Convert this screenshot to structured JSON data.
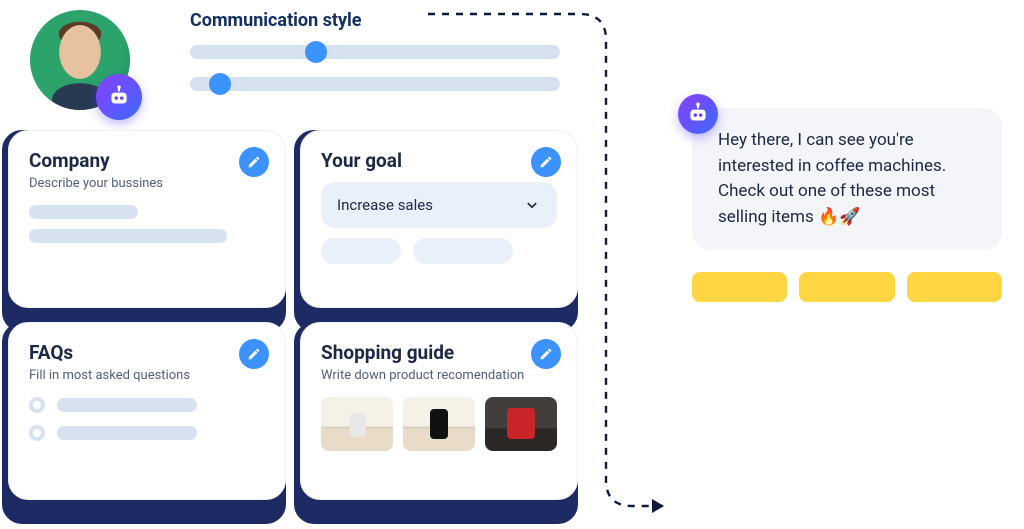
{
  "communication": {
    "title": "Communication style",
    "slider1_pct": 34,
    "slider2_pct": 8
  },
  "cards": {
    "company": {
      "title": "Company",
      "subtitle": "Describe your bussines"
    },
    "goal": {
      "title": "Your goal",
      "select_value": "Increase sales"
    },
    "faqs": {
      "title": "FAQs",
      "subtitle": "Fill in most asked questions"
    },
    "guide": {
      "title": "Shopping guide",
      "subtitle": "Write down product recomendation"
    }
  },
  "chat": {
    "message": "Hey there, I can see you're interested in coffee machines. Check out one of these most selling items 🔥🚀"
  }
}
